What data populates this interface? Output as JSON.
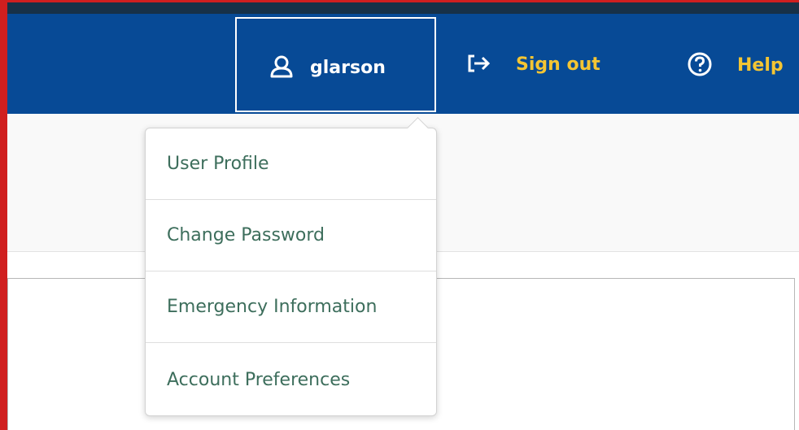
{
  "header": {
    "username": "glarson",
    "sign_out_label": "Sign out",
    "help_label": "Help",
    "icons": {
      "user": "user-icon",
      "sign_out": "sign-out-icon",
      "help": "help-circle-icon"
    }
  },
  "user_menu": {
    "items": [
      {
        "label": "User Profile"
      },
      {
        "label": "Change Password"
      },
      {
        "label": "Emergency Information"
      },
      {
        "label": "Account Preferences"
      }
    ]
  },
  "colors": {
    "header_bg": "#074a96",
    "accent_yellow": "#f4c533",
    "menu_text": "#3d6e5c",
    "border_red": "#d01f1f"
  }
}
